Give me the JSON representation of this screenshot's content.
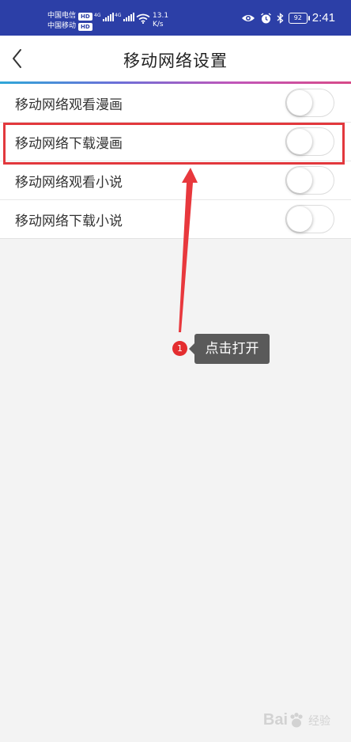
{
  "status_bar": {
    "carrier_1": "中国电信",
    "carrier_2": "中国移动",
    "hd_label": "HD",
    "network_type": "4G",
    "network_speed_value": "13.1",
    "network_speed_unit": "K/s",
    "battery_level": "92",
    "time": "2:41"
  },
  "header": {
    "title": "移动网络设置"
  },
  "settings": {
    "items": [
      {
        "label": "移动网络观看漫画",
        "enabled": false
      },
      {
        "label": "移动网络下载漫画",
        "enabled": false
      },
      {
        "label": "移动网络观看小说",
        "enabled": false
      },
      {
        "label": "移动网络下载小说",
        "enabled": false
      }
    ]
  },
  "annotation": {
    "step_number": "1",
    "tooltip_text": "点击打开",
    "highlight_color": "#e2383d"
  },
  "watermark": {
    "text": "Bai",
    "suffix": "经验"
  },
  "colors": {
    "status_bar_bg": "#2c3fa7",
    "page_bg": "#f3f3f3",
    "annotation_red": "#e2383d",
    "tooltip_bg": "#5a5a5a"
  }
}
